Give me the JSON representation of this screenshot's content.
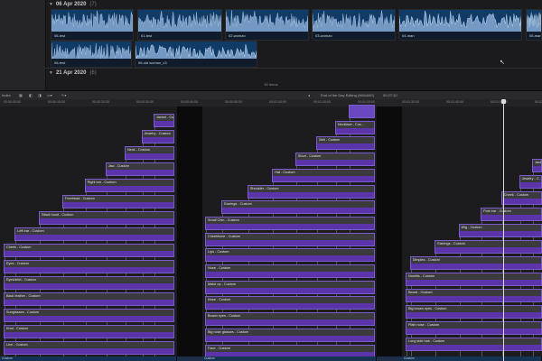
{
  "browser": {
    "groups": [
      {
        "date": "06 Apr 2020",
        "count": "(7)"
      },
      {
        "date": "21 Apr 2020",
        "count": "(6)"
      }
    ],
    "clips_row1": [
      {
        "label": "06-test"
      },
      {
        "label": "01-test"
      },
      {
        "label": "02-woman"
      },
      {
        "label": "03-woman"
      },
      {
        "label": "04-man"
      },
      {
        "label": "05-man"
      }
    ],
    "clips_row2": [
      {
        "label": "06-test"
      },
      {
        "label": "06-old woman_c3"
      }
    ],
    "items_count": "60 items"
  },
  "toolbar": {
    "index_label": "Index",
    "title": "End of the Day Editing (960x540)",
    "timecode": "00:27:10"
  },
  "ruler": {
    "ticks": [
      "00:00:00:00",
      "00:00:10:00",
      "00:00:20:00",
      "00:00:30:00",
      "00:00:40:00",
      "00:00:50:00",
      "00:01:00:00",
      "00:01:10:00",
      "00:01:20:00",
      "00:01:30:00",
      "00:01:40:00",
      "00:01:50:00",
      "00:02:00:00"
    ]
  },
  "timeline": {
    "groups": [
      {
        "clips": [
          "Jacket - Cu...",
          "Jewelry - Custom",
          "Neck - Custom",
          "Jaw - Custom",
          "Right ear - Custom",
          "Forehead - Custom",
          "Black hood - Custom",
          "Left ear - Custom",
          "Cheek - Custom",
          "Eyes - Custom",
          "Eyeshield - Custom",
          "Back leather - Custom",
          "Sunglasses - Custom",
          "Knot - Custom",
          "Line - Custom"
        ]
      },
      {
        "clips": [
          "",
          "Necklace - Cus...",
          "Belt - Custom",
          "Short - Custom",
          "Hat - Custom",
          "Shoulder - Custom",
          "Earrings - Custom",
          "Small Chin - Custom",
          "Cheekbone - Custom",
          "Lips - Custom",
          "Nose - Custom",
          "Make up - Custom",
          "Nose - Custom",
          "Brown eyes - Custom",
          "Big nose glasses - Custom",
          "Face - Custom"
        ]
      },
      {
        "clips": [
          "Jacket...",
          "Jewelry - C...",
          "Cheek - Custom",
          "Pole ear - Custom",
          "Wig - Custom",
          "Earrings - Custom",
          "Dimples - Custom",
          "Nostrils - Custom",
          "Beard - Custom",
          "Big brown eyes - Custom",
          "Plain nose - Custom",
          "Long side hair - Custom"
        ]
      }
    ],
    "storyline": [
      "Custom",
      "Custom",
      "Custom"
    ]
  }
}
